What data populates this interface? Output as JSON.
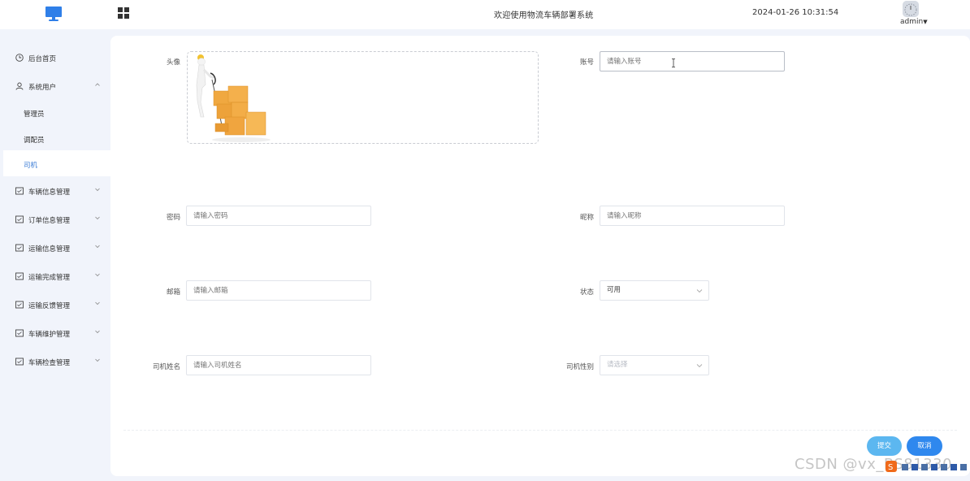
{
  "header": {
    "title": "欢迎使用物流车辆部署系统",
    "datetime": "2024-01-26 10:31:54",
    "user": "admin",
    "icons": [
      "monitor-logo-icon",
      "grid-menu-icon",
      "avatar"
    ]
  },
  "sidebar": {
    "items": [
      {
        "label": "后台首页",
        "icon": "clock-icon"
      },
      {
        "label": "系统用户",
        "icon": "user-icon",
        "expanded": true,
        "children": [
          {
            "label": "管理员"
          },
          {
            "label": "调配员"
          },
          {
            "label": "司机",
            "active": true
          }
        ]
      },
      {
        "label": "车辆信息管理",
        "icon": "list-icon"
      },
      {
        "label": "订单信息管理",
        "icon": "list-icon"
      },
      {
        "label": "运输信息管理",
        "icon": "list-icon"
      },
      {
        "label": "运输完成管理",
        "icon": "list-icon"
      },
      {
        "label": "运输反馈管理",
        "icon": "list-icon"
      },
      {
        "label": "车辆维护管理",
        "icon": "list-icon"
      },
      {
        "label": "车辆检查管理",
        "icon": "list-icon"
      }
    ]
  },
  "form": {
    "avatar_label": "头像",
    "account": {
      "label": "账号",
      "placeholder": "请输入账号"
    },
    "password": {
      "label": "密码",
      "placeholder": "请输入密码"
    },
    "nickname": {
      "label": "昵称",
      "placeholder": "请输入昵称"
    },
    "email": {
      "label": "邮箱",
      "placeholder": "请输入邮箱"
    },
    "status": {
      "label": "状态",
      "value": "可用"
    },
    "driver_name": {
      "label": "司机姓名",
      "placeholder": "请输入司机姓名"
    },
    "driver_gender": {
      "label": "司机性别",
      "placeholder": "请选择"
    },
    "submit_label": "提交",
    "cancel_label": "取消"
  },
  "watermark": "CSDN @vx_BS81330",
  "colors": {
    "accent": "#2f88ee",
    "submit": "#5cb7f0",
    "active_nav": "#3a7bd5",
    "background": "#f1f4fb"
  }
}
